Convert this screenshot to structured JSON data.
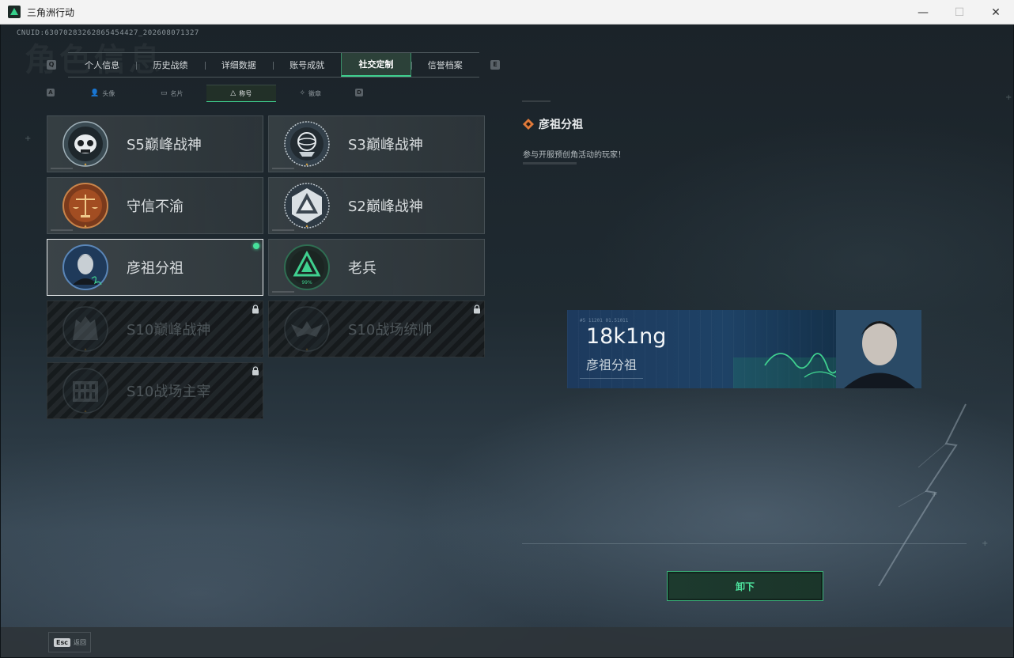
{
  "window": {
    "title": "三角洲行动",
    "minimize": "—",
    "maximize": "☐",
    "close": "✕"
  },
  "header": {
    "uid": "CNUID:6307028326286545442​7_202608071327",
    "watermark": "角色信息"
  },
  "main_tabs": [
    {
      "label": "个人信息",
      "active": false
    },
    {
      "label": "历史战绩",
      "active": false
    },
    {
      "label": "详细数据",
      "active": false
    },
    {
      "label": "账号成就",
      "active": false
    },
    {
      "label": "社交定制",
      "active": true
    },
    {
      "label": "信誉档案",
      "active": false
    }
  ],
  "key_hints": {
    "prev_main": "Q",
    "next_main": "E",
    "prev_sub": "A",
    "next_sub": "D"
  },
  "sub_tabs": [
    {
      "label": "头像",
      "icon": "person-icon",
      "glyph": "👤",
      "active": false
    },
    {
      "label": "名片",
      "icon": "card-icon",
      "glyph": "▭",
      "active": false
    },
    {
      "label": "称号",
      "icon": "triangle-icon",
      "glyph": "△",
      "active": true
    },
    {
      "label": "徽章",
      "icon": "badge-icon",
      "glyph": "✧",
      "active": false
    }
  ],
  "cards": [
    {
      "label": "S5巅峰战神",
      "locked": false,
      "selected": false
    },
    {
      "label": "S3巅峰战神",
      "locked": false,
      "selected": false
    },
    {
      "label": "守信不渝",
      "locked": false,
      "selected": false
    },
    {
      "label": "S2巅峰战神",
      "locked": false,
      "selected": false
    },
    {
      "label": "彦祖分祖",
      "locked": false,
      "selected": true
    },
    {
      "label": "老兵",
      "locked": false,
      "selected": false,
      "badge_text": "99%"
    },
    {
      "label": "S10巅峰战神",
      "locked": true,
      "selected": false
    },
    {
      "label": "S10战场统帅",
      "locked": true,
      "selected": false
    },
    {
      "label": "S10战场主宰",
      "locked": true,
      "selected": false
    }
  ],
  "detail": {
    "title": "彦祖分祖",
    "description": "参与开服预创角活动的玩家！",
    "banner": {
      "player_name": "18k1ng",
      "title": "彦祖分祖",
      "code": "#5 11201  01.51011"
    },
    "unequip_label": "卸下"
  },
  "footer": {
    "esc_key": "Esc",
    "esc_label": "返回"
  },
  "colors": {
    "accent": "#3fd08f",
    "selected_dot": "#46e19b",
    "banner_blue": "#1e4266"
  }
}
